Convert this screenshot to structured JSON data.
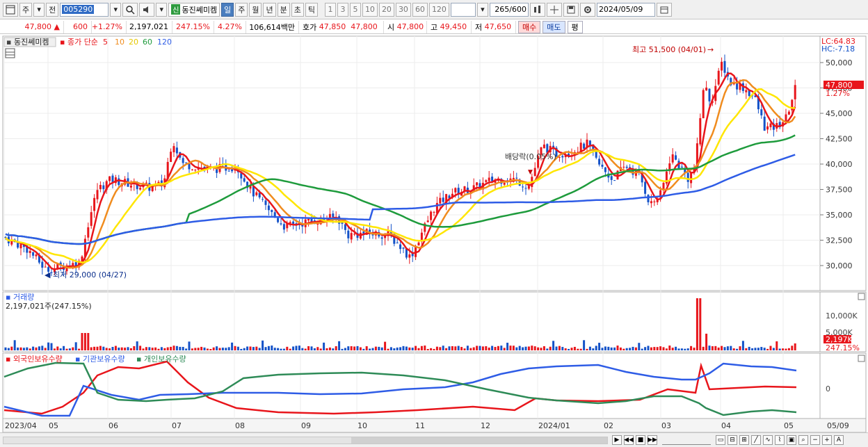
{
  "toolbar": {
    "period_main": "주",
    "period_sub": "전",
    "stock_code": "005290",
    "badge": "신",
    "stock_name": "동진쎄미켐",
    "intervals": [
      "일",
      "주",
      "월",
      "년",
      "분",
      "초",
      "틱"
    ],
    "selected_interval": "일",
    "minute_options": [
      "1",
      "3",
      "5",
      "10",
      "20",
      "30",
      "60",
      "120"
    ],
    "bar_count": "265",
    "bar_max": "/600",
    "date": "2024/05/09",
    "icons": [
      "window-icon",
      "dropdown-icon",
      "search-icon",
      "speaker-icon",
      "compare-icon",
      "cross-icon",
      "save-icon",
      "settings-icon",
      "calendar-icon"
    ]
  },
  "quote": {
    "price": "47,800",
    "change_arrow": "▲",
    "change": "600",
    "change_pct": "+1.27%",
    "volume": "2,197,021",
    "volume_ratio": "247.15%",
    "turnover": "4.27%",
    "amount": "106,614백만",
    "bid_label": "호가",
    "bid1": "47,850",
    "bid2": "47,800",
    "open_label": "시",
    "open": "47,800",
    "high_label": "고",
    "high": "49,450",
    "low_label": "저",
    "low": "47,650",
    "buy_button": "매수",
    "sell_button": "매도",
    "eval_button": "평"
  },
  "price_panel": {
    "stock_label": "동진쎄미켐",
    "ma_title": "종가 단순",
    "ma_periods": [
      "5",
      "10",
      "20",
      "60",
      "120"
    ],
    "ma_colors": [
      "#e8151b",
      "#f08c1e",
      "#ffe600",
      "#1e9b3c",
      "#2e5ce6"
    ],
    "lc_label": "LC:64.83",
    "hc_label": "HC:-7.18",
    "price_tag": "47,800",
    "pct_tag": "1.27%",
    "high_annotation": "최고 51,500 (04/01)",
    "low_annotation": "최저 29,000 (04/27)",
    "dividend_annotation": "배당락(0.05%)",
    "y_ticks": [
      "50,000",
      "47,500",
      "45,000",
      "42,500",
      "40,000",
      "37,500",
      "35,000",
      "32,500",
      "30,000"
    ]
  },
  "volume_panel": {
    "title": "거래량",
    "value": "2,197,021주(247.15%)",
    "y_ticks": [
      "10,000K",
      "5,000K"
    ],
    "tag_value": "2,197K",
    "tag_pct": "247.15%"
  },
  "holdings_panel": {
    "series": [
      {
        "name": "외국인보유수량",
        "color": "#e8151b"
      },
      {
        "name": "기관보유수량",
        "color": "#2e5ce6"
      },
      {
        "name": "개인보유수량",
        "color": "#2e8b57"
      }
    ],
    "y_tick": "0"
  },
  "x_labels": [
    "2023/04",
    "05",
    "06",
    "07",
    "08",
    "09",
    "10",
    "11",
    "12",
    "2024/01",
    "02",
    "03",
    "04",
    "05",
    "05/09"
  ]
}
